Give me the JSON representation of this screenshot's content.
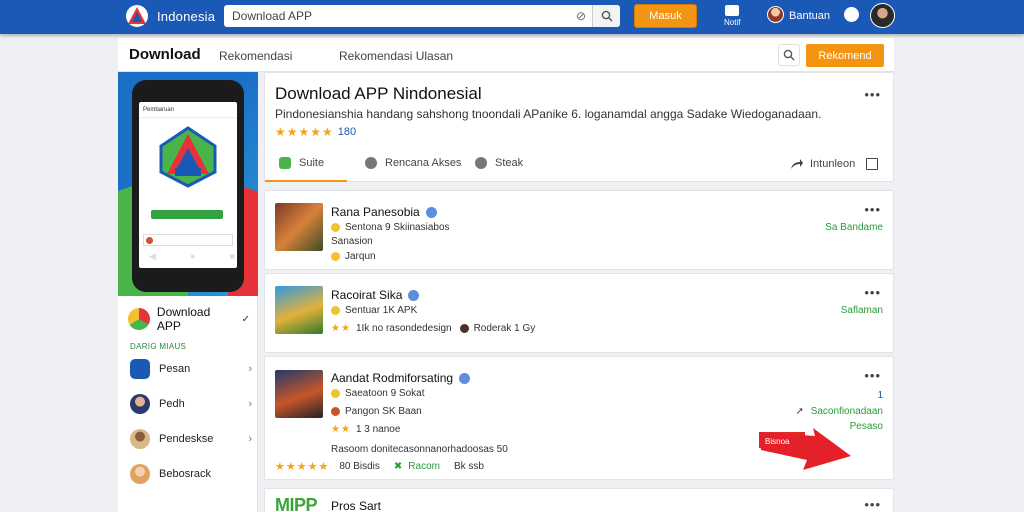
{
  "topbar": {
    "brand": "Indonesia",
    "search_value": "Download APP",
    "clear_icon": "⊘",
    "button_label": "Masuk",
    "notif_label": "Notif",
    "user_label": "Bantuan"
  },
  "subnav": {
    "title": "Download",
    "links": [
      "Rekomendasi",
      "Rekomendasi Ulasan"
    ],
    "button_label": "Rekomend"
  },
  "sidebar": {
    "app_label": "Download APP",
    "check": "✓",
    "section_label": "DARIG MIAUS",
    "items": [
      {
        "label": "Pesan",
        "color": "#1a59b5"
      },
      {
        "label": "Pedh",
        "color": "#2b3a6b"
      },
      {
        "label": "Pendeskse",
        "color": "#d9b98a"
      },
      {
        "label": "Bebosrack",
        "color": "#e0a25d"
      }
    ],
    "phone": {
      "header": "Pembaruan"
    }
  },
  "header": {
    "title": "Download APP Nindonesial",
    "description": "Pindonesianshia handang sahshong tnoondali APanike 6. loganamdal angga Sadake Wiedoganadaan.",
    "stars": "★★★★★",
    "rating": "180"
  },
  "tabs": [
    {
      "label": "Suite"
    },
    {
      "label": "Rencana Akses"
    },
    {
      "label": "Steak"
    }
  ],
  "tab_right": {
    "label": "Intunleon"
  },
  "apps": [
    {
      "name": "Rana Panesobia",
      "line1": "Sentona 9 Skiinasiabos",
      "line2": "Sanasion",
      "line3": "Jarqun",
      "download": "Sa Bandame"
    },
    {
      "name": "Racoirat Sika",
      "line1": "Sentuar 1K APK",
      "stars": "★★",
      "line2": "1Ik no rasondedesign",
      "user": "Roderak 1 Gy",
      "download": "Saflaman"
    },
    {
      "name": "Aandat Rodmiforsating",
      "line1": "Saeatoon 9 Sokat",
      "line2": "Pangon SK Baan",
      "stars2": "★★",
      "line3": "1 3 nanoe",
      "line4": "Rasoom donitecasonnanorhadoosas 50",
      "stars3": "★★★★★",
      "stat1": "80 Bisdis",
      "stat2": "Racom",
      "stat3": "Bk ssb",
      "num": "1",
      "download": "Saconfionadaan",
      "download2": "Pesaso",
      "badge": "Bisnoa"
    },
    {
      "name": "Pros Sart",
      "logo_text": "MIPP"
    }
  ]
}
